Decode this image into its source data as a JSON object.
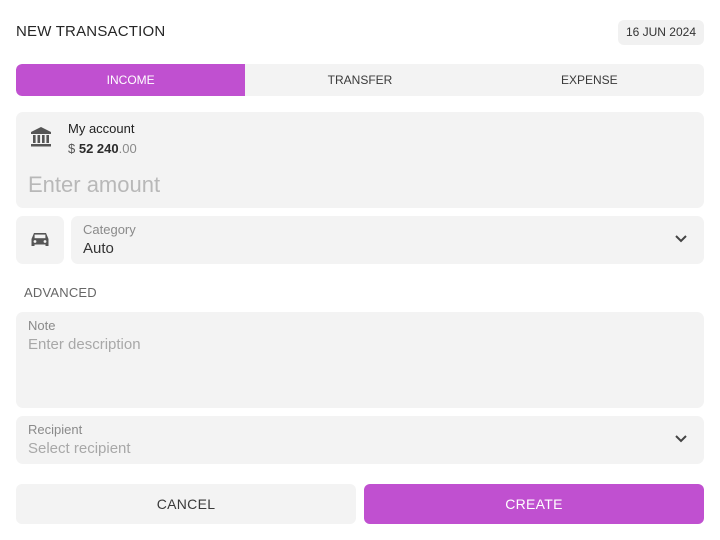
{
  "header": {
    "title": "NEW TRANSACTION",
    "date": "16 JUN 2024"
  },
  "tabs": [
    {
      "label": "INCOME",
      "active": true
    },
    {
      "label": "TRANSFER",
      "active": false
    },
    {
      "label": "EXPENSE",
      "active": false
    }
  ],
  "account": {
    "name": "My account",
    "currency": "$",
    "balance_main": "52 240",
    "balance_cents": ".00",
    "icon": "bank-icon"
  },
  "amount": {
    "placeholder": "Enter amount",
    "value": ""
  },
  "category": {
    "label": "Category",
    "value": "Auto",
    "icon": "car-icon"
  },
  "advanced_label": "ADVANCED",
  "note": {
    "label": "Note",
    "placeholder": "Enter description",
    "value": ""
  },
  "recipient": {
    "label": "Recipient",
    "placeholder": "Select recipient"
  },
  "actions": {
    "cancel": "CANCEL",
    "create": "CREATE"
  },
  "colors": {
    "accent": "#c050d0",
    "field_bg": "#f3f3f3",
    "text": "#2b2b2b"
  }
}
